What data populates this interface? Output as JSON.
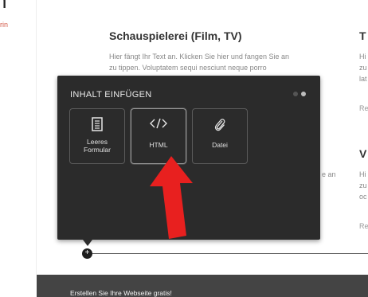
{
  "left_fragment": {
    "glyph": "n",
    "small_text": "rin"
  },
  "col1": {
    "heading": "Schauspielerei (Film, TV)",
    "text_line1": "Hier fängt Ihr Text an. Klicken Sie hier und fangen Sie an",
    "text_line2": "zu tippen. Voluptatem sequi nesciunt neque porro",
    "text_fragment": "e an"
  },
  "col2": {
    "heading1": "T",
    "text1": [
      "Hi",
      "zu",
      "lat"
    ],
    "link1": "Re",
    "heading2": "V",
    "text2": [
      "Hi",
      "zu",
      "oc"
    ],
    "link2": "Re"
  },
  "overlay": {
    "title": "INHALT EINFÜGEN",
    "tiles": [
      {
        "label": "Leeres Formular",
        "icon": "form-icon"
      },
      {
        "label": "HTML",
        "icon": "code-icon"
      },
      {
        "label": "Datei",
        "icon": "paperclip-icon"
      }
    ]
  },
  "timeline": {
    "node_symbol": "+"
  },
  "footer": {
    "text": "Erstellen Sie Ihre Webseite gratis!"
  },
  "colors": {
    "overlay_bg": "#2b2b2b",
    "arrow": "#e8201f",
    "footer_bg": "#444444"
  }
}
